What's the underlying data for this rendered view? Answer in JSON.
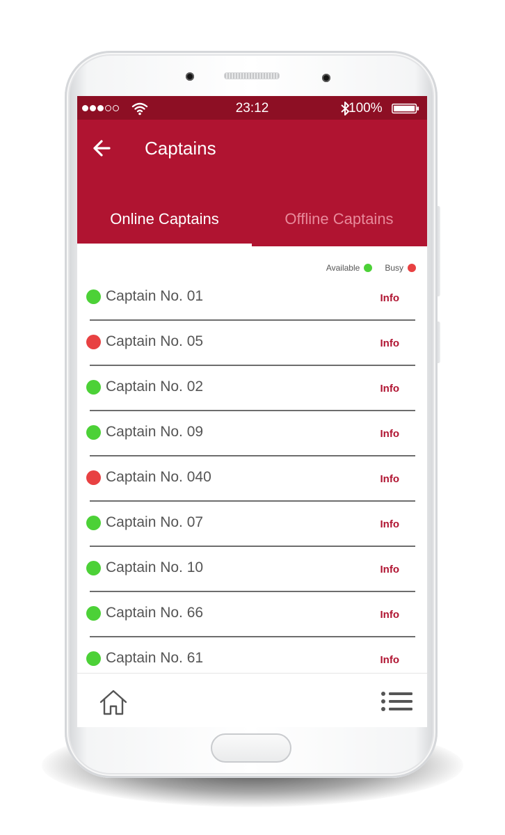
{
  "status_bar": {
    "time": "23:12",
    "battery": "100%",
    "signal_dots": [
      "full",
      "full",
      "full",
      "empty",
      "empty"
    ],
    "icons": [
      "signal-dots-icon",
      "wifi-icon",
      "bluetooth-icon",
      "battery-icon"
    ]
  },
  "app_bar": {
    "title": "Captains",
    "back_icon": "arrow-left-icon",
    "color": "#b01431",
    "status_color": "#8d0f24"
  },
  "tabs": [
    {
      "label": "Online Captains",
      "active": true
    },
    {
      "label": "Offline Captains",
      "active": false
    }
  ],
  "legend": {
    "available_label": "Available",
    "available_color": "#4cd137",
    "busy_label": "Busy",
    "busy_color": "#e84142"
  },
  "captains": [
    {
      "name": "Captain No. 01",
      "status": "available",
      "action": "Info"
    },
    {
      "name": "Captain No. 05",
      "status": "busy",
      "action": "Info"
    },
    {
      "name": "Captain No. 02",
      "status": "available",
      "action": "Info"
    },
    {
      "name": "Captain No. 09",
      "status": "available",
      "action": "Info"
    },
    {
      "name": "Captain No. 040",
      "status": "busy",
      "action": "Info"
    },
    {
      "name": "Captain No. 07",
      "status": "available",
      "action": "Info"
    },
    {
      "name": "Captain No. 10",
      "status": "available",
      "action": "Info"
    },
    {
      "name": "Captain No. 66",
      "status": "available",
      "action": "Info"
    },
    {
      "name": "Captain No. 61",
      "status": "available",
      "action": "Info"
    }
  ],
  "bottom_nav": {
    "icons": [
      "home-icon",
      "menu-list-icon"
    ]
  }
}
